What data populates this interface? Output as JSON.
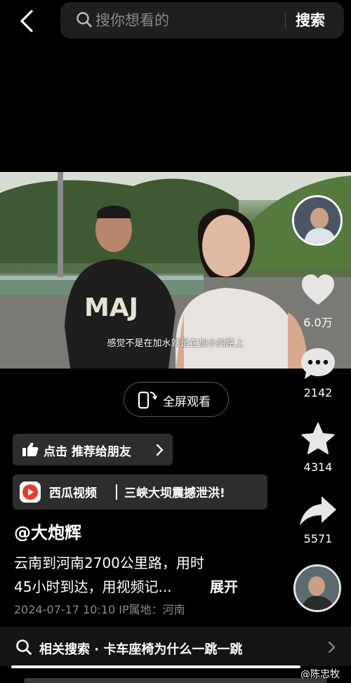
{
  "header": {
    "search_placeholder": "搜你想看的",
    "search_button": "搜索"
  },
  "video": {
    "caption": "感觉不是在加水就是在加水的路上",
    "fullscreen_label": "全屏观看"
  },
  "rail": {
    "likes": "6.0万",
    "comments": "2142",
    "favorites": "4314",
    "shares": "5571"
  },
  "recommend": {
    "label": "点击 推荐给朋友"
  },
  "source": {
    "app_name": "西瓜视频",
    "title": "三峡大坝震撼泄洪!"
  },
  "post": {
    "username": "@大炮辉",
    "desc_line1": "云南到河南2700公里路，用时",
    "desc_line2": "45小时到达，用视频记...",
    "expand": "展开",
    "meta": "2024-07-17 10:10  IP属地：河南"
  },
  "related": {
    "label": "相关搜索 · 卡车座椅为什么一跳一跳"
  },
  "watermark": "@陈忠牧",
  "icons": {
    "back": "chevron-left-icon",
    "search": "search-icon",
    "like": "heart-icon",
    "comment": "comment-icon",
    "favorite": "star-icon",
    "share": "share-arrow-icon",
    "fullscreen": "rotate-screen-icon",
    "thumb": "thumbs-up-icon",
    "chevron": "chevron-right-icon"
  }
}
